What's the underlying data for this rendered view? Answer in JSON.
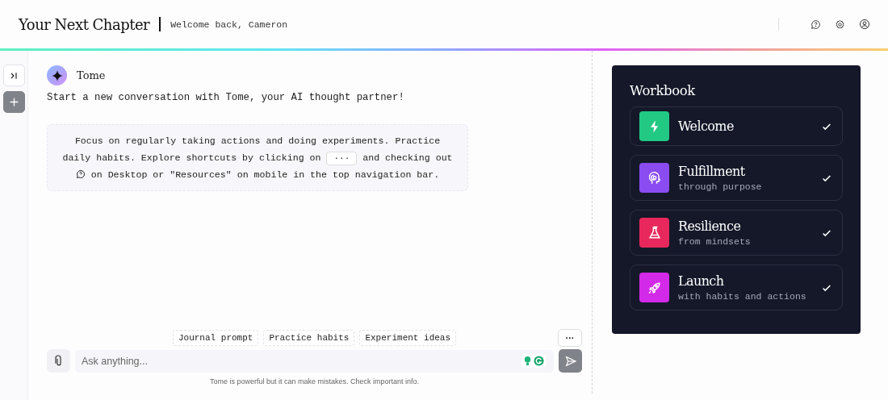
{
  "header": {
    "title": "Your Next Chapter",
    "greeting": "Welcome back, Cameron"
  },
  "assistant": {
    "name": "Tome",
    "intro": "Start a new conversation with Tome, your AI thought partner!"
  },
  "tip": {
    "before": "Focus on regularly taking actions and doing experiments. Practice daily habits. Explore shortcuts by clicking on",
    "key": "···",
    "middle": "and checking out",
    "after": "on Desktop or \"Resources\" on mobile in the top navigation bar."
  },
  "suggestions": [
    "Journal prompt",
    "Practice habits",
    "Experiment ideas"
  ],
  "more_button": "···",
  "composer": {
    "placeholder": "Ask anything...",
    "disclaimer": "Tome is powerful but it can make mistakes. Check important info."
  },
  "workbook": {
    "title": "Workbook",
    "items": [
      {
        "kind": "bolt",
        "title": "Welcome",
        "color": "#22c983",
        "done": true
      },
      {
        "kind": "head",
        "title": "Fulfillment",
        "subtitle": "through purpose",
        "color": "#8a4cf0",
        "done": true
      },
      {
        "kind": "flask",
        "title": "Resilience",
        "subtitle": "from mindsets",
        "color": "#e8285c",
        "done": true
      },
      {
        "kind": "rocket",
        "title": "Launch",
        "subtitle": "with habits and actions",
        "color": "#d22ae8",
        "done": true
      }
    ]
  }
}
